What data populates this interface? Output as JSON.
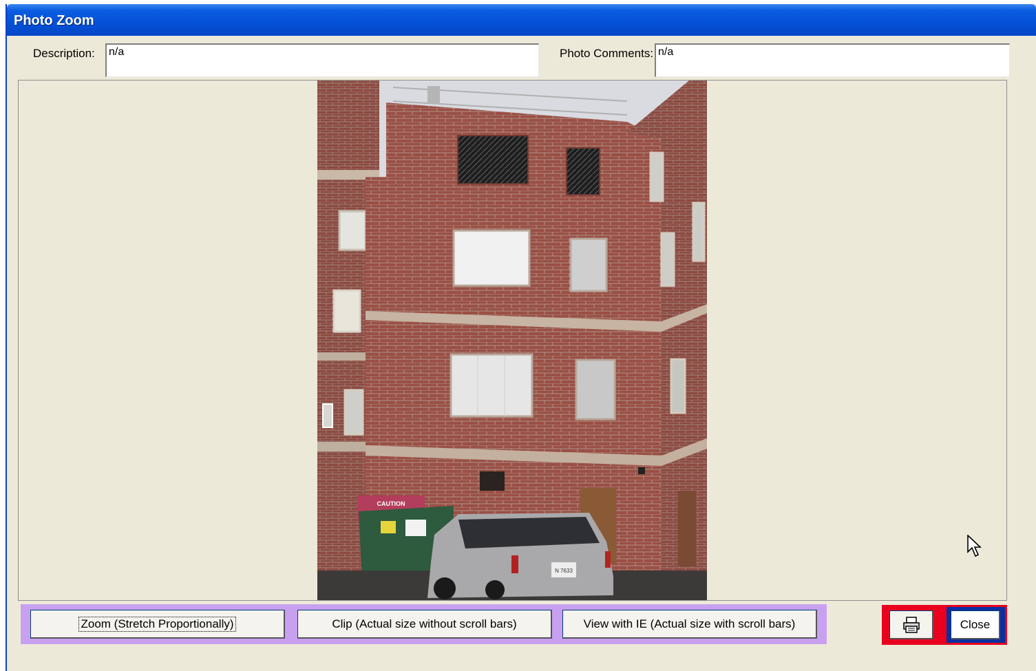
{
  "window": {
    "title": "Photo Zoom"
  },
  "fields": {
    "description_label": "Description:",
    "description_value": "n/a",
    "comments_label": "Photo Comments:",
    "comments_value": "n/a"
  },
  "photo": {
    "sign_text": "CAUTION",
    "plate_text": "N 7633"
  },
  "buttons": {
    "zoom": "Zoom (Stretch Proportionally)",
    "clip": "Clip (Actual size without scroll bars)",
    "view_ie": "View with IE (Actual size with scroll bars)",
    "close": "Close",
    "print_icon": "printer-icon"
  },
  "colors": {
    "titlebar": "#0550D8",
    "window_bg": "#ECE9D8",
    "group_highlight": "#C8A0F0",
    "print_highlight": "#E8001E",
    "close_highlight": "#0A2FA0"
  }
}
